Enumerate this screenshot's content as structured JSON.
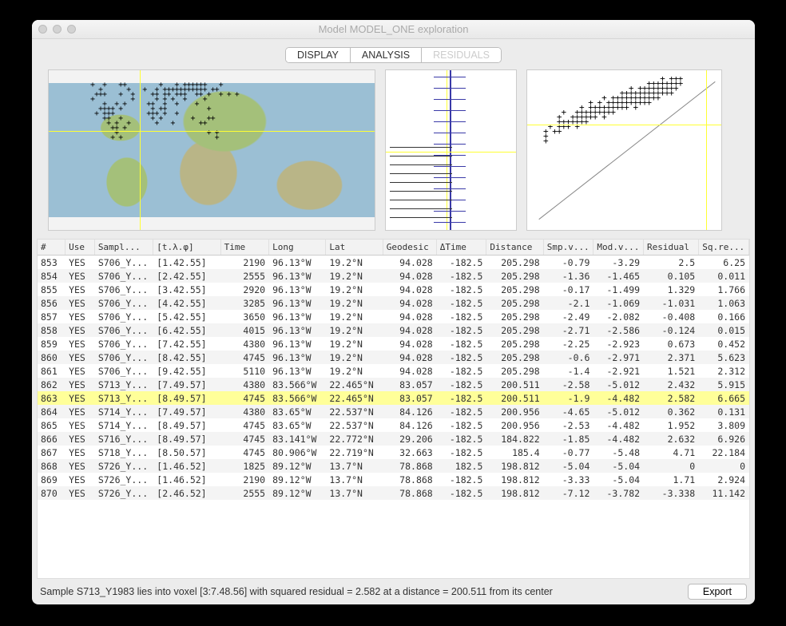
{
  "window": {
    "title": "Model MODEL_ONE exploration"
  },
  "tabs": [
    {
      "label": "DISPLAY",
      "active": false,
      "disabled": false
    },
    {
      "label": "ANALYSIS",
      "active": true,
      "disabled": false
    },
    {
      "label": "RESIDUALS",
      "active": false,
      "disabled": true
    }
  ],
  "table": {
    "headers": [
      "#",
      "Use",
      "Sampl...",
      "[t.λ.φ]",
      "Time",
      "Long",
      "Lat",
      "Geodesic",
      "ΔTime",
      "Distance",
      "Smp.v...",
      "Mod.v...",
      "Residual",
      "Sq.re..."
    ],
    "selected_index": 863,
    "rows": [
      {
        "idx": "853",
        "use": "YES",
        "samp": "S706_Y...",
        "voxel": "[1.42.55]",
        "time": "2190",
        "lon": "96.13°W",
        "lat": "19.2°N",
        "geo": "94.028",
        "dt": "-182.5",
        "dist": "205.298",
        "smp": "-0.79",
        "mod": "-3.29",
        "res": "2.5",
        "sq": "6.25"
      },
      {
        "idx": "854",
        "use": "YES",
        "samp": "S706_Y...",
        "voxel": "[2.42.55]",
        "time": "2555",
        "lon": "96.13°W",
        "lat": "19.2°N",
        "geo": "94.028",
        "dt": "-182.5",
        "dist": "205.298",
        "smp": "-1.36",
        "mod": "-1.465",
        "res": "0.105",
        "sq": "0.011"
      },
      {
        "idx": "855",
        "use": "YES",
        "samp": "S706_Y...",
        "voxel": "[3.42.55]",
        "time": "2920",
        "lon": "96.13°W",
        "lat": "19.2°N",
        "geo": "94.028",
        "dt": "-182.5",
        "dist": "205.298",
        "smp": "-0.17",
        "mod": "-1.499",
        "res": "1.329",
        "sq": "1.766"
      },
      {
        "idx": "856",
        "use": "YES",
        "samp": "S706_Y...",
        "voxel": "[4.42.55]",
        "time": "3285",
        "lon": "96.13°W",
        "lat": "19.2°N",
        "geo": "94.028",
        "dt": "-182.5",
        "dist": "205.298",
        "smp": "-2.1",
        "mod": "-1.069",
        "res": "-1.031",
        "sq": "1.063"
      },
      {
        "idx": "857",
        "use": "YES",
        "samp": "S706_Y...",
        "voxel": "[5.42.55]",
        "time": "3650",
        "lon": "96.13°W",
        "lat": "19.2°N",
        "geo": "94.028",
        "dt": "-182.5",
        "dist": "205.298",
        "smp": "-2.49",
        "mod": "-2.082",
        "res": "-0.408",
        "sq": "0.166"
      },
      {
        "idx": "858",
        "use": "YES",
        "samp": "S706_Y...",
        "voxel": "[6.42.55]",
        "time": "4015",
        "lon": "96.13°W",
        "lat": "19.2°N",
        "geo": "94.028",
        "dt": "-182.5",
        "dist": "205.298",
        "smp": "-2.71",
        "mod": "-2.586",
        "res": "-0.124",
        "sq": "0.015"
      },
      {
        "idx": "859",
        "use": "YES",
        "samp": "S706_Y...",
        "voxel": "[7.42.55]",
        "time": "4380",
        "lon": "96.13°W",
        "lat": "19.2°N",
        "geo": "94.028",
        "dt": "-182.5",
        "dist": "205.298",
        "smp": "-2.25",
        "mod": "-2.923",
        "res": "0.673",
        "sq": "0.452"
      },
      {
        "idx": "860",
        "use": "YES",
        "samp": "S706_Y...",
        "voxel": "[8.42.55]",
        "time": "4745",
        "lon": "96.13°W",
        "lat": "19.2°N",
        "geo": "94.028",
        "dt": "-182.5",
        "dist": "205.298",
        "smp": "-0.6",
        "mod": "-2.971",
        "res": "2.371",
        "sq": "5.623"
      },
      {
        "idx": "861",
        "use": "YES",
        "samp": "S706_Y...",
        "voxel": "[9.42.55]",
        "time": "5110",
        "lon": "96.13°W",
        "lat": "19.2°N",
        "geo": "94.028",
        "dt": "-182.5",
        "dist": "205.298",
        "smp": "-1.4",
        "mod": "-2.921",
        "res": "1.521",
        "sq": "2.312"
      },
      {
        "idx": "862",
        "use": "YES",
        "samp": "S713_Y...",
        "voxel": "[7.49.57]",
        "time": "4380",
        "lon": "83.566°W",
        "lat": "22.465°N",
        "geo": "83.057",
        "dt": "-182.5",
        "dist": "200.511",
        "smp": "-2.58",
        "mod": "-5.012",
        "res": "2.432",
        "sq": "5.915"
      },
      {
        "idx": "863",
        "use": "YES",
        "samp": "S713_Y...",
        "voxel": "[8.49.57]",
        "time": "4745",
        "lon": "83.566°W",
        "lat": "22.465°N",
        "geo": "83.057",
        "dt": "-182.5",
        "dist": "200.511",
        "smp": "-1.9",
        "mod": "-4.482",
        "res": "2.582",
        "sq": "6.665"
      },
      {
        "idx": "864",
        "use": "YES",
        "samp": "S714_Y...",
        "voxel": "[7.49.57]",
        "time": "4380",
        "lon": "83.65°W",
        "lat": "22.537°N",
        "geo": "84.126",
        "dt": "-182.5",
        "dist": "200.956",
        "smp": "-4.65",
        "mod": "-5.012",
        "res": "0.362",
        "sq": "0.131"
      },
      {
        "idx": "865",
        "use": "YES",
        "samp": "S714_Y...",
        "voxel": "[8.49.57]",
        "time": "4745",
        "lon": "83.65°W",
        "lat": "22.537°N",
        "geo": "84.126",
        "dt": "-182.5",
        "dist": "200.956",
        "smp": "-2.53",
        "mod": "-4.482",
        "res": "1.952",
        "sq": "3.809"
      },
      {
        "idx": "866",
        "use": "YES",
        "samp": "S716_Y...",
        "voxel": "[8.49.57]",
        "time": "4745",
        "lon": "83.141°W",
        "lat": "22.772°N",
        "geo": "29.206",
        "dt": "-182.5",
        "dist": "184.822",
        "smp": "-1.85",
        "mod": "-4.482",
        "res": "2.632",
        "sq": "6.926"
      },
      {
        "idx": "867",
        "use": "YES",
        "samp": "S718_Y...",
        "voxel": "[8.50.57]",
        "time": "4745",
        "lon": "80.906°W",
        "lat": "22.719°N",
        "geo": "32.663",
        "dt": "-182.5",
        "dist": "185.4",
        "smp": "-0.77",
        "mod": "-5.48",
        "res": "4.71",
        "sq": "22.184"
      },
      {
        "idx": "868",
        "use": "YES",
        "samp": "S726_Y...",
        "voxel": "[1.46.52]",
        "time": "1825",
        "lon": "89.12°W",
        "lat": "13.7°N",
        "geo": "78.868",
        "dt": "182.5",
        "dist": "198.812",
        "smp": "-5.04",
        "mod": "-5.04",
        "res": "0",
        "sq": "0"
      },
      {
        "idx": "869",
        "use": "YES",
        "samp": "S726_Y...",
        "voxel": "[1.46.52]",
        "time": "2190",
        "lon": "89.12°W",
        "lat": "13.7°N",
        "geo": "78.868",
        "dt": "-182.5",
        "dist": "198.812",
        "smp": "-3.33",
        "mod": "-5.04",
        "res": "1.71",
        "sq": "2.924"
      },
      {
        "idx": "870",
        "use": "YES",
        "samp": "S726_Y...",
        "voxel": "[2.46.52]",
        "time": "2555",
        "lon": "89.12°W",
        "lat": "13.7°N",
        "geo": "78.868",
        "dt": "-182.5",
        "dist": "198.812",
        "smp": "-7.12",
        "mod": "-3.782",
        "res": "-3.338",
        "sq": "11.142"
      }
    ]
  },
  "status": "Sample S713_Y1983 lies into voxel [3:7.48.56] with squared residual = 2.582 at a distance = 200.511 from its center",
  "buttons": {
    "export": "Export"
  },
  "map": {
    "crosshair_x_pct": 28,
    "crosshair_y_pct": 38
  },
  "scatter": {
    "crosshair_x_pct": 92,
    "crosshair_y_pct": 34
  }
}
